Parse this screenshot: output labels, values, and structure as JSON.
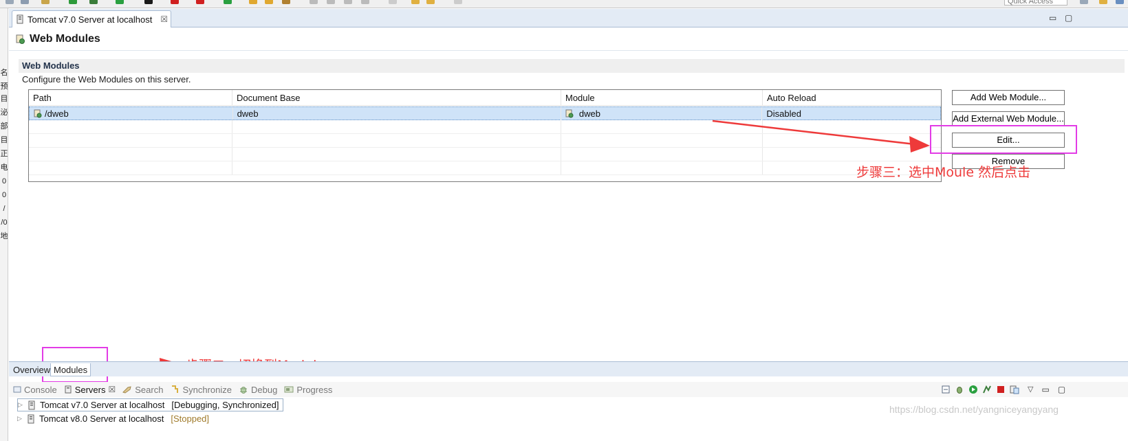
{
  "editor": {
    "tab_label": "Tomcat v7.0 Server at localhost",
    "tab_close": "☒"
  },
  "toolbar": {
    "quick_access": "Quick Access"
  },
  "left_strip_glyphs": [
    "名",
    "预",
    "目",
    "泌",
    "部",
    "目",
    "正",
    "电",
    "0",
    "0",
    "/",
    "/0",
    "地"
  ],
  "page": {
    "title": "Web Modules"
  },
  "section": {
    "title": "Web Modules",
    "description": "Configure the Web Modules on this server."
  },
  "table": {
    "columns": [
      "Path",
      "Document Base",
      "Module",
      "Auto Reload"
    ],
    "rows": [
      {
        "path": "/dweb",
        "document_base": "dweb",
        "module": "dweb",
        "auto_reload": "Disabled"
      }
    ]
  },
  "buttons": {
    "add_web_module": "Add Web Module...",
    "add_external_web_module": "Add External Web Module...",
    "edit": "Edit...",
    "remove": "Remove"
  },
  "editor_pages": {
    "overview": "Overview",
    "modules": "Modules"
  },
  "annotations": {
    "step3": "步骤三：选中Moule  然后点击",
    "step2": "步骤二：切换到Modules"
  },
  "views": {
    "console": "Console",
    "servers": "Servers",
    "servers_close": "☒",
    "search": "Search",
    "synchronize": "Synchronize",
    "debug": "Debug",
    "progress": "Progress"
  },
  "servers": [
    {
      "name": "Tomcat v7.0 Server at localhost",
      "state": "[Debugging, Synchronized]"
    },
    {
      "name": "Tomcat v8.0 Server at localhost",
      "state": "[Stopped]"
    }
  ],
  "watermark": "https://blog.csdn.net/yangniceyangyang",
  "colors": {
    "annotation_red": "#ee3a3a",
    "annotation_box": "#e23be6",
    "selection": "#cfe3f8",
    "tab_bar": "#e3ebf5"
  }
}
